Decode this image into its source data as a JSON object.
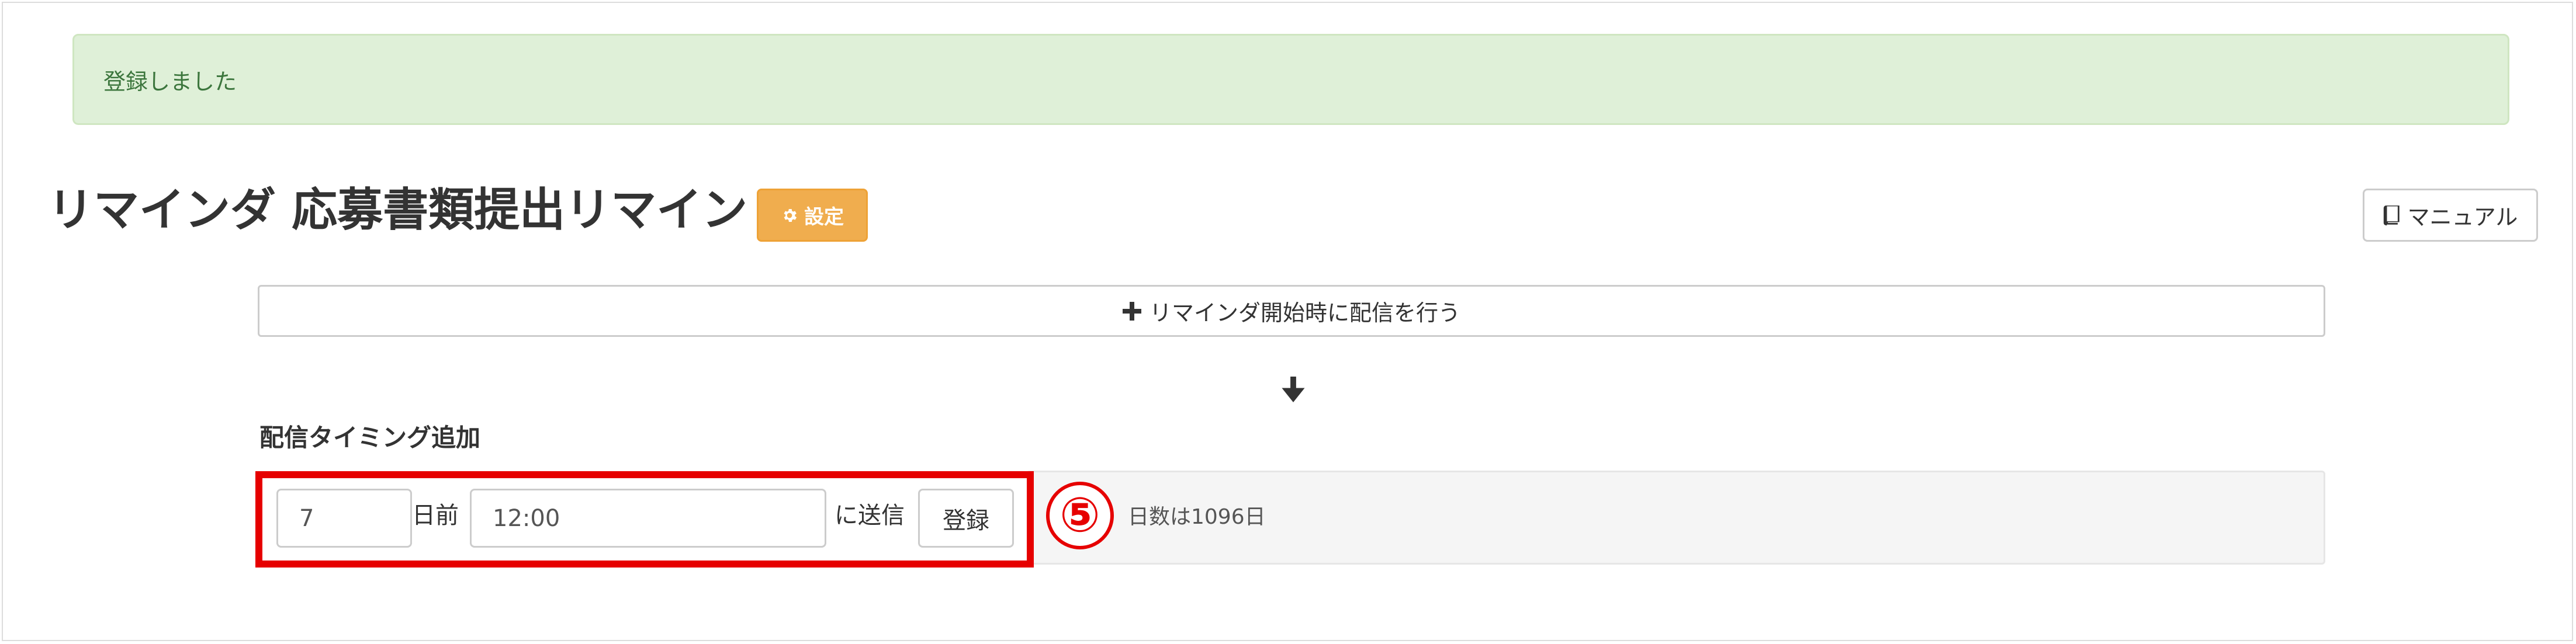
{
  "alert": {
    "message": "登録しました",
    "bg_color": "#dff0d8",
    "text_color": "#3c763d"
  },
  "header": {
    "title": "リマインダ 応募書類提出リマインド",
    "settings_label": "設定",
    "manual_label": "マニュアル",
    "settings_color": "#f0ad4e"
  },
  "start_button": {
    "label": "リマインダ開始時に配信を行う",
    "icon": "plus-icon"
  },
  "timing": {
    "section_label": "配信タイミング追加",
    "days_value": "7",
    "days_suffix": "日前",
    "time_value": "12:00",
    "send_suffix": "に送信",
    "register_label": "登録",
    "info_text": "日数は1096日"
  },
  "annotation": {
    "step": "⑤",
    "color": "#e60000"
  }
}
